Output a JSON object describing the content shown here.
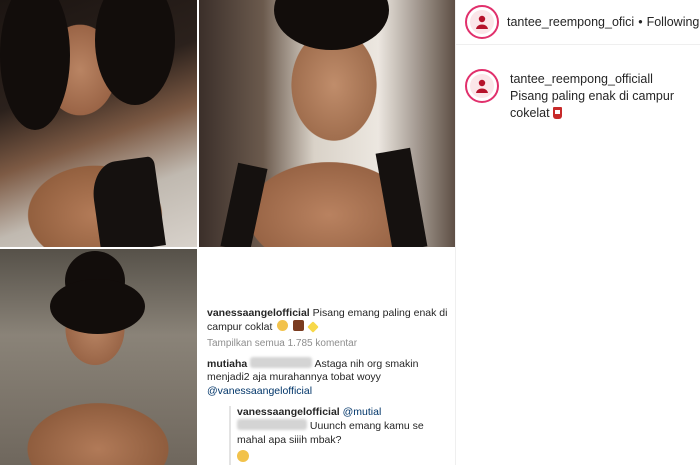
{
  "post": {
    "author": "tantee_reempong_ofici",
    "follow_separator": "•",
    "follow_status": "Following"
  },
  "caption": {
    "username": "tantee_reempong_officiall",
    "text": "Pisang paling enak di campur cokelat"
  },
  "comments_screenshot": {
    "top_comment": {
      "username": "vanessaangelofficial",
      "text": "Pisang emang paling enak di campur coklat"
    },
    "view_all": "Tampilkan semua 1.785 komentar",
    "comment_2": {
      "username": "mutiaha",
      "text": "Astaga nih org smakin menjadi2 aja murahannya tobat woyy",
      "mention": "@vanessaangelofficial"
    },
    "reply": {
      "username": "vanessaangelofficial",
      "mention": "@mutial",
      "text": "Uuunch emang kamu se mahal apa siiih mbak?"
    }
  },
  "icons": {
    "avatar": "brand-avatar-icon",
    "drink": "tumbler-emoji-icon"
  },
  "colors": {
    "avatar_ring": "#e1306c",
    "text": "#262626",
    "muted": "#8e8e8e",
    "link": "#003569"
  }
}
